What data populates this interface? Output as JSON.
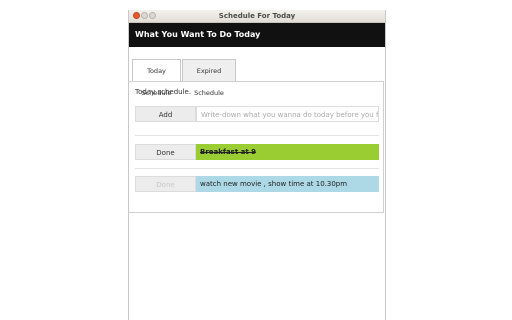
{
  "window": {
    "title": "Schedule For Today"
  },
  "header": {
    "title": "What You Want To Do Today"
  },
  "tabs": [
    {
      "label": "Today Schedule",
      "active": true
    },
    {
      "label": "Expired Schedule",
      "active": false
    }
  ],
  "panel": {
    "subtitle": "Today schedule.",
    "add_button": "Add",
    "input_placeholder": "Write-down what you wanna do today before you forget"
  },
  "items": [
    {
      "button_label": "Done",
      "text": "Breakfast at 9",
      "status": "done",
      "color": "#9acd32"
    },
    {
      "button_label": "Done",
      "text": "watch new movie , show time at 10.30pm",
      "status": "pending",
      "color": "#add8e6"
    }
  ],
  "colors": {
    "header_bg": "#111111",
    "close_button": "#e8592e"
  }
}
